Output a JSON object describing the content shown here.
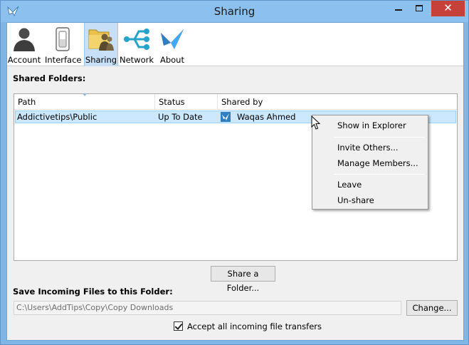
{
  "window": {
    "title": "Sharing",
    "title_icon": "copy-bird-icon",
    "close_glyph": "✕",
    "colors": {
      "frame": "#7fb6e6",
      "close": "#c7413b",
      "selection": "#cce8ff"
    }
  },
  "toolbar": {
    "items": [
      {
        "label": "Account",
        "icon": "person-icon"
      },
      {
        "label": "Interface",
        "icon": "switch-icon"
      },
      {
        "label": "Sharing",
        "icon": "shared-folder-icon",
        "active": true
      },
      {
        "label": "Network",
        "icon": "network-icon"
      },
      {
        "label": "About",
        "icon": "copy-bird-icon"
      }
    ]
  },
  "shared_folders": {
    "heading": "Shared Folders:",
    "columns": [
      "Path",
      "Status",
      "Shared by"
    ],
    "rows": [
      {
        "path": "Addictivetips\\Public",
        "status": "Up To Date",
        "shared_by": "Waqas Ahmed"
      }
    ]
  },
  "context_menu": {
    "items": [
      "Show in Explorer",
      "Invite Others...",
      "Manage Members...",
      "Leave",
      "Un-share"
    ]
  },
  "share_folder_button": "Share a Folder...",
  "incoming": {
    "heading": "Save Incoming Files to this Folder:",
    "path_value": "C:\\Users\\AddTips\\Copy\\Copy Downloads",
    "change_button": "Change...",
    "accept_label": "Accept all incoming file transfers",
    "accept_checked": true
  }
}
